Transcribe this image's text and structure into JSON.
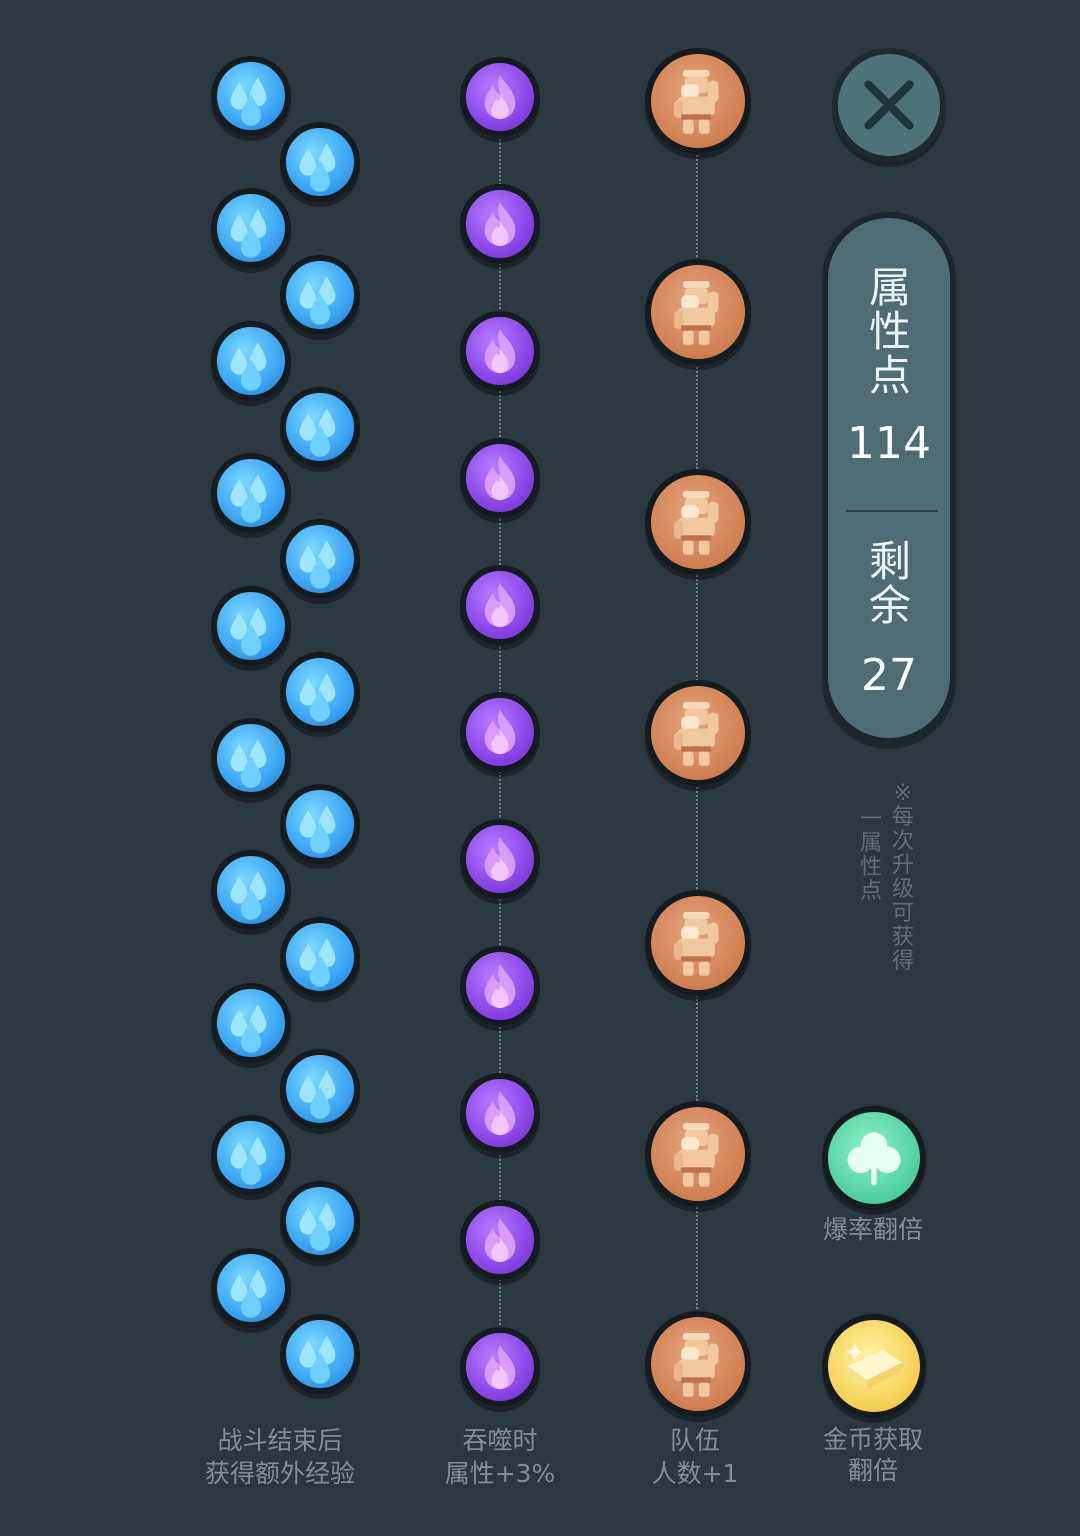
{
  "close_button": {
    "icon": "close-icon"
  },
  "stats": {
    "attr_label": "属性点",
    "attr_value": "114",
    "remaining_label": "剩余",
    "remaining_value": "27"
  },
  "note": {
    "line1": "※每次升级可获得",
    "line2": "一属性点"
  },
  "columns": {
    "water": {
      "label": "战斗结束后\n获得额外经验",
      "icon": "water-drop-icon",
      "count": 20
    },
    "fire": {
      "label": "吞噬时\n属性+3%",
      "icon": "flame-icon",
      "count": 11
    },
    "hero": {
      "label": "队伍\n人数+1",
      "icon": "warrior-icon",
      "count": 7
    }
  },
  "bonuses": {
    "drop_rate": {
      "label": "爆率翻倍",
      "icon": "clover-icon"
    },
    "gold": {
      "label": "金币获取\n翻倍",
      "icon": "gold-bar-icon"
    }
  },
  "colors": {
    "background": "#2c3840",
    "water": "#3fa9f5",
    "fire": "#8a46e8",
    "hero": "#cf7f52",
    "panel": "#4f6b73"
  }
}
